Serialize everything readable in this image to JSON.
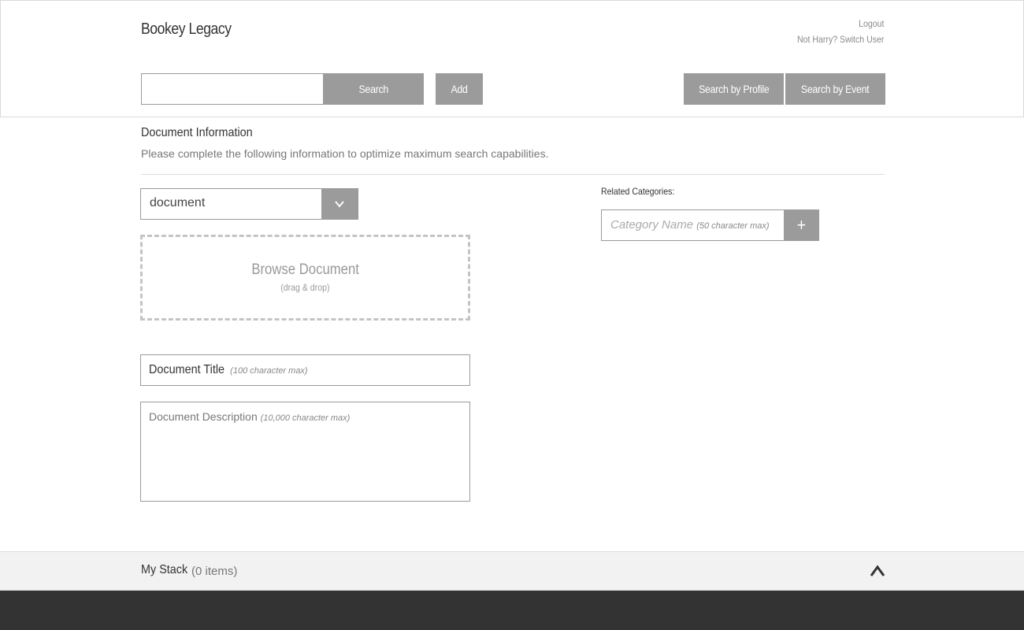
{
  "header": {
    "brand": "Bookey Legacy",
    "logout": "Logout",
    "switch_user": "Not Harry? Switch User"
  },
  "toolbar": {
    "search_placeholder": "",
    "search_label": "Search",
    "add_label": "Add",
    "search_profile_label": "Search by Profile",
    "search_event_label": "Search by Event"
  },
  "document_info": {
    "title": "Document Information",
    "subtitle": "Please complete the following information to optimize maximum search capabilities.",
    "type_select": {
      "value": "document",
      "arrow_icon": "chevron-down-icon"
    },
    "dropzone": {
      "title": "Browse Document",
      "subtitle": "(drag & drop)"
    },
    "title_field": {
      "label": "Document Title",
      "hint": "(100 character max)"
    },
    "description_field": {
      "label": "Document Description",
      "hint": "(10,000 character max)"
    }
  },
  "related": {
    "label": "Related Categories:",
    "category_placeholder": "Category Name",
    "category_hint": "(50 character max)",
    "add_icon": "+"
  },
  "stack": {
    "title": "My Stack",
    "count": "(0 items)",
    "toggle_icon": "chevron-up-icon"
  },
  "colors": {
    "button": "#9b9b9b",
    "footer": "#333333",
    "stack_bar": "#f2f2f2"
  }
}
